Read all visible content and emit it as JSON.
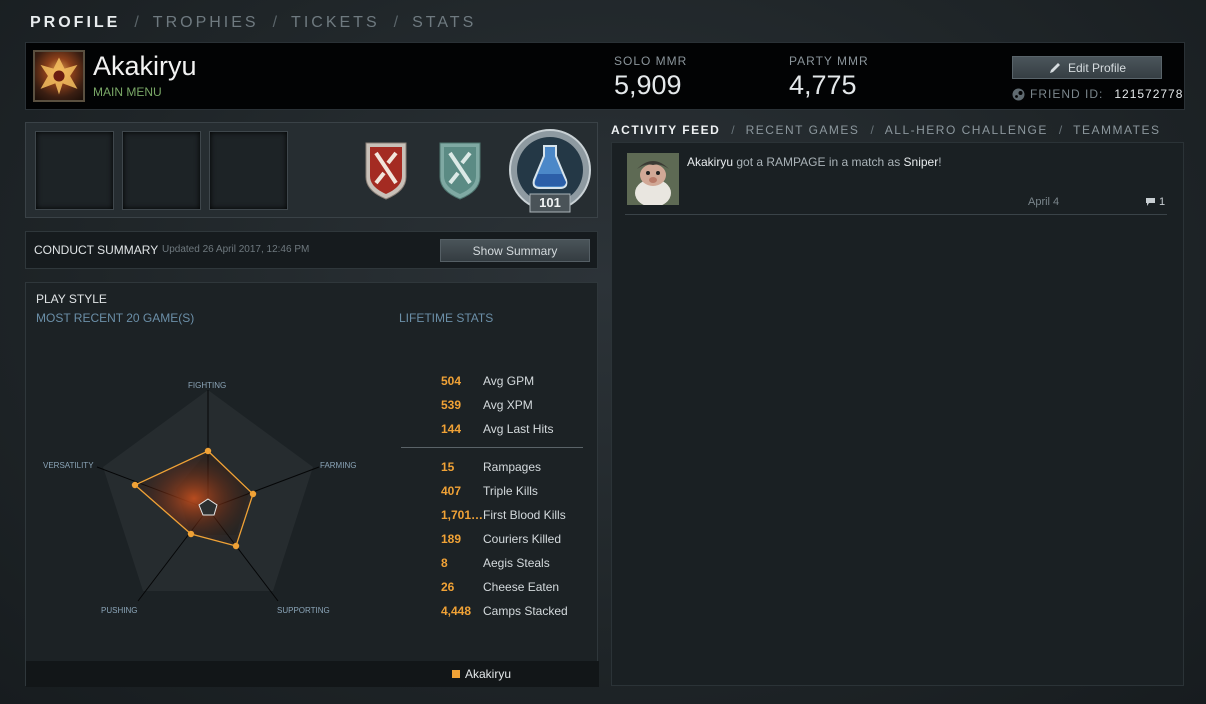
{
  "topnav": {
    "tabs": [
      "PROFILE",
      "TROPHIES",
      "TICKETS",
      "STATS"
    ],
    "separator": "/"
  },
  "profile": {
    "name": "Akakiryu",
    "subtitle": "MAIN MENU",
    "solo_mmr_label": "SOLO MMR",
    "solo_mmr": "5,909",
    "party_mmr_label": "PARTY MMR",
    "party_mmr": "4,775",
    "edit_label": "Edit Profile",
    "friend_id_label": "FRIEND ID:",
    "friend_id": "121572778"
  },
  "badges": {
    "level": "101"
  },
  "conduct": {
    "title": "CONDUCT SUMMARY",
    "updated": "Updated 26 April 2017, 12:46 PM",
    "button": "Show Summary"
  },
  "playstyle": {
    "title": "PLAY STYLE",
    "recent_label": "MOST RECENT 20 GAME(S)",
    "lifetime_label": "LIFETIME STATS",
    "axes": [
      "FIGHTING",
      "FARMING",
      "SUPPORTING",
      "PUSHING",
      "VERSATILITY"
    ],
    "legend": "Akakiryu",
    "accent": "#f0a236",
    "stats_top": [
      {
        "value": "504",
        "label": "Avg GPM"
      },
      {
        "value": "539",
        "label": "Avg XPM"
      },
      {
        "value": "144",
        "label": "Avg Last Hits"
      }
    ],
    "stats_bottom": [
      {
        "value": "15",
        "label": "Rampages"
      },
      {
        "value": "407",
        "label": "Triple Kills"
      },
      {
        "value": "1,701…",
        "label": "First Blood Kills"
      },
      {
        "value": "189",
        "label": "Couriers Killed"
      },
      {
        "value": "8",
        "label": "Aegis Steals"
      },
      {
        "value": "26",
        "label": "Cheese Eaten"
      },
      {
        "value": "4,448",
        "label": "Camps Stacked"
      }
    ]
  },
  "rightnav": {
    "tabs": [
      "ACTIVITY FEED",
      "RECENT GAMES",
      "ALL-HERO CHALLENGE",
      "TEAMMATES"
    ]
  },
  "feed": {
    "items": [
      {
        "player": "Akakiryu",
        "text_mid": " got a RAMPAGE in a match as ",
        "hero": "Sniper",
        "suffix": "!",
        "date": "April 4",
        "comments": "1"
      }
    ]
  }
}
